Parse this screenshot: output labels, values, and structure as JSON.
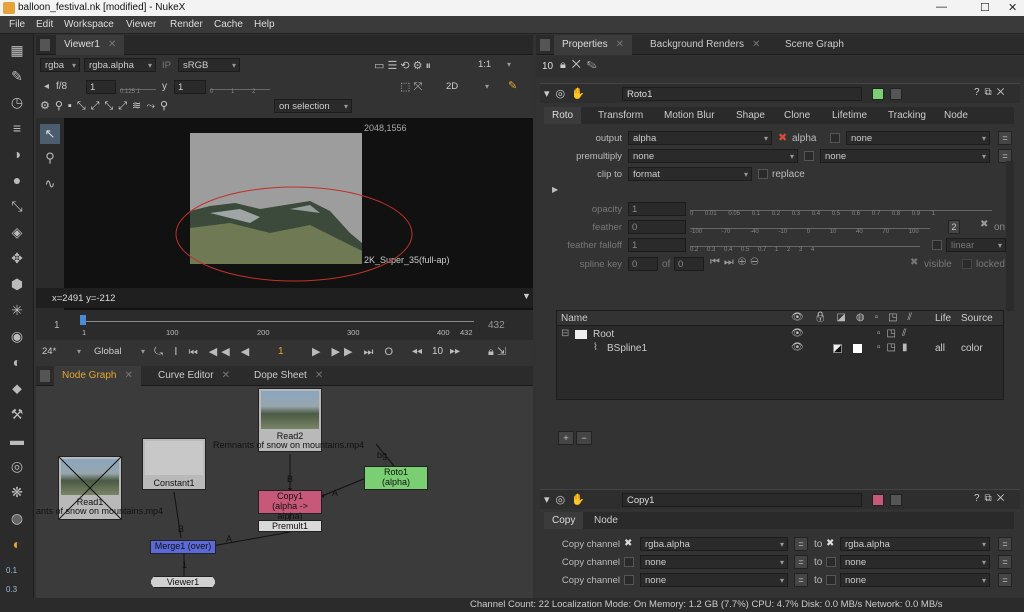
{
  "window": {
    "title": "balloon_festival.nk [modified] - NukeX",
    "minimize": "—",
    "maximize": "☐",
    "close": "✕"
  },
  "menu": [
    "File",
    "Edit",
    "Workspace",
    "Viewer",
    "Render",
    "Cache",
    "Help"
  ],
  "viewer": {
    "tab": "Viewer1",
    "channels": "rgba",
    "channel_sel": "rgba.alpha",
    "ip": "IP",
    "colorspace": "sRGB",
    "zoom": "1:1",
    "fstop": "f/8",
    "gain": "1",
    "gain_ticks": "0.125 1",
    "gamma_label": "y",
    "gamma": "1",
    "gamma_ticks": "0 1 2",
    "mode2d": "2D",
    "on_selection": "on selection",
    "res_label": "2048,1556",
    "format_label": "2K_Super_35(full-ap)",
    "coords": "x=2491 y=-212",
    "timeline": {
      "start": "1",
      "end": "432",
      "ticks": [
        "1",
        "100",
        "200",
        "300",
        "400",
        "432"
      ],
      "frame_left": "1"
    },
    "fps": "24*",
    "global": "Global",
    "frame": "1",
    "step": "10"
  },
  "nodegraph": {
    "tabs": [
      "Node Graph",
      "Curve Editor",
      "Dope Sheet"
    ],
    "nodes": {
      "read2": {
        "name": "Read2",
        "sub": "Remnants of snow on mountains.mp4"
      },
      "read1": {
        "name": "Read1",
        "sub": "ants of snow on mountains.mp4"
      },
      "constant": {
        "name": "Constant1"
      },
      "roto": {
        "name": "Roto1",
        "sub": "(alpha)"
      },
      "copy": {
        "name": "Copy1",
        "sub": "(alpha -> alpha)"
      },
      "premult": {
        "name": "Premult1"
      },
      "merge": {
        "name": "Merge1 (over)"
      },
      "viewer": {
        "name": "Viewer1"
      }
    },
    "pipe_labels": {
      "bg": "bg",
      "b1": "B",
      "a1": "A",
      "b2": "B",
      "a2": "A",
      "one": "1"
    }
  },
  "status": {
    "cpu_meter": [
      "0.1",
      "0.3"
    ],
    "line": "Channel Count: 22  Localization Mode: On  Memory: 1.2 GB (7.7%)  CPU: 4.7%  Disk: 0.0 MB/s  Network: 0.0 MB/s"
  },
  "props": {
    "tabs": [
      "Properties",
      "Background Renders",
      "Scene Graph"
    ],
    "max_panels": "10",
    "roto": {
      "name": "Roto1",
      "tabs": [
        "Roto",
        "Transform",
        "Motion Blur",
        "Shape",
        "Clone",
        "Lifetime",
        "Tracking",
        "Node"
      ],
      "output_label": "output",
      "output": "alpha",
      "alpha_label": "alpha",
      "output_none": "none",
      "premult_label": "premultiply",
      "premult": "none",
      "premult_none": "none",
      "clip_label": "clip to",
      "clip": "format",
      "replace": "replace",
      "opacity_label": "opacity",
      "opacity": "1",
      "opacity_ticks": "0 0.01 0.05 0.1 0.2 0.3 0.4 0.5 0.6 0.7 0.8 0.9 1",
      "feather_label": "feather",
      "feather": "0",
      "feather_ticks": "-100 -70 -40 -10 0 10 40 70 100",
      "feather_num": "2",
      "on": "on",
      "falloff_label": "feather falloff",
      "falloff": "1",
      "falloff_ticks": "0.2 0.3 0.4 0.5 0.7 1 2 3 4",
      "falloff_mode": "linear",
      "splinekey_label": "spline key",
      "splinekey": "0",
      "of": "of",
      "splinekey_total": "0",
      "visible": "visible",
      "locked": "locked",
      "table_headers": {
        "name": "Name",
        "life": "Life",
        "source": "Source"
      },
      "rows": [
        {
          "name": "Root",
          "life": "",
          "source": ""
        },
        {
          "name": "BSpline1",
          "life": "all",
          "source": "color"
        }
      ],
      "add": "+",
      "remove": "−"
    },
    "copy": {
      "name": "Copy1",
      "tabs": [
        "Copy",
        "Node"
      ],
      "rows": [
        {
          "label": "Copy channel",
          "from": "rgba.alpha",
          "to_label": "to",
          "to": "rgba.alpha"
        },
        {
          "label": "Copy channel",
          "from": "none",
          "to_label": "to",
          "to": "none"
        },
        {
          "label": "Copy channel",
          "from": "none",
          "to_label": "to",
          "to": "none"
        }
      ]
    }
  }
}
